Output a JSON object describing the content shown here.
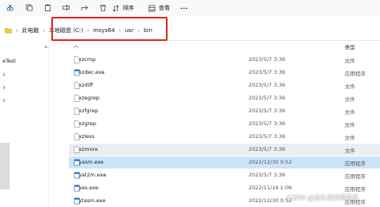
{
  "toolbar": {
    "sort_label": "排序",
    "view_label": "查看"
  },
  "breadcrumb": [
    "此电脑",
    "本地磁盘 (C:)",
    "msys64",
    "usr",
    "bin"
  ],
  "sidebar": {
    "items": [
      "eTest"
    ]
  },
  "columns": {
    "type_header": "类型"
  },
  "files": [
    {
      "name": "xzcmp",
      "date": "2023/5/7 3:36",
      "type": "文件",
      "kind": "file"
    },
    {
      "name": "xzdec.exe",
      "date": "2023/5/7 3:36",
      "type": "应用程序",
      "kind": "exe"
    },
    {
      "name": "xzdiff",
      "date": "2023/5/7 3:36",
      "type": "文件",
      "kind": "file"
    },
    {
      "name": "xzegrep",
      "date": "2023/5/7 3:36",
      "type": "文件",
      "kind": "file"
    },
    {
      "name": "xzfgrep",
      "date": "2023/5/7 3:36",
      "type": "文件",
      "kind": "file"
    },
    {
      "name": "xzgrep",
      "date": "2023/5/7 3:36",
      "type": "文件",
      "kind": "file"
    },
    {
      "name": "xzless",
      "date": "2023/5/7 3:36",
      "type": "文件",
      "kind": "file"
    },
    {
      "name": "xzmore",
      "date": "2023/5/7 3:36",
      "type": "文件",
      "kind": "file"
    },
    {
      "name": "yasm.exe",
      "date": "2022/12/30 0:52",
      "type": "应用程序",
      "kind": "exe"
    },
    {
      "name": "yat2m.exe",
      "date": "2023/5/7 3:36",
      "type": "应用程序",
      "kind": "exe"
    },
    {
      "name": "yes.exe",
      "date": "2022/11/16 1:06",
      "type": "应用程序",
      "kind": "exe"
    },
    {
      "name": "ytasm.exe",
      "date": "2022/12/30 0:52",
      "type": "应用程序",
      "kind": "exe"
    }
  ],
  "watermark": "CSDN @会头发的程序员"
}
